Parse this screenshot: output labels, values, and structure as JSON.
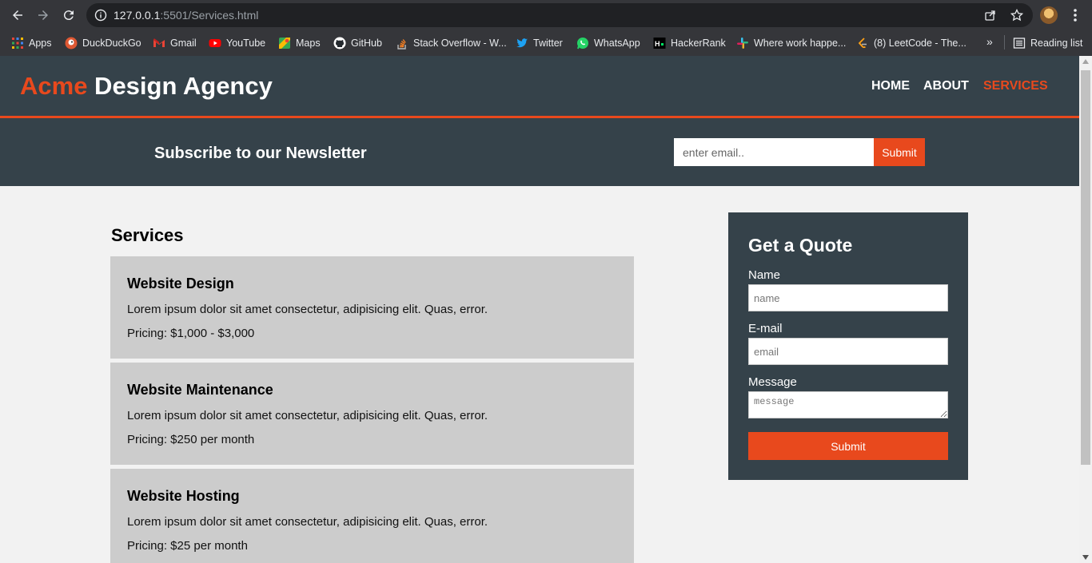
{
  "browser": {
    "url_host": "127.0.0.1",
    "url_rest": ":5501/Services.html",
    "bookmarks": [
      {
        "label": "Apps",
        "icon": "apps-grid-icon",
        "color": "#4285f4"
      },
      {
        "label": "DuckDuckGo",
        "icon": "duckduckgo-icon",
        "color": "#de5833"
      },
      {
        "label": "Gmail",
        "icon": "gmail-icon",
        "color": "#ea4335"
      },
      {
        "label": "YouTube",
        "icon": "youtube-icon",
        "color": "#ff0000"
      },
      {
        "label": "Maps",
        "icon": "maps-icon",
        "color": "#34a853"
      },
      {
        "label": "GitHub",
        "icon": "github-icon",
        "color": "#ffffff"
      },
      {
        "label": "Stack Overflow - W...",
        "icon": "stackoverflow-icon",
        "color": "#f48024"
      },
      {
        "label": "Twitter",
        "icon": "twitter-icon",
        "color": "#1da1f2"
      },
      {
        "label": "WhatsApp",
        "icon": "whatsapp-icon",
        "color": "#25d366"
      },
      {
        "label": "HackerRank",
        "icon": "hackerrank-icon",
        "color": "#000000"
      },
      {
        "label": "Where work happe...",
        "icon": "slack-icon",
        "color": "#e01e5a"
      },
      {
        "label": "(8) LeetCode - The...",
        "icon": "leetcode-icon",
        "color": "#ffa116"
      }
    ],
    "bookmarks_more": "»",
    "reading_list": "Reading list"
  },
  "site": {
    "brand_highlight": "Acme",
    "brand_rest": " Design Agency",
    "nav": [
      {
        "label": "Home",
        "active": false
      },
      {
        "label": "About",
        "active": false
      },
      {
        "label": "Services",
        "active": true
      }
    ],
    "accent_color": "#e8491d",
    "header_color": "#35424a"
  },
  "newsletter": {
    "title": "Subscribe to our Newsletter",
    "email_placeholder": "enter email..",
    "submit_label": "Submit"
  },
  "main": {
    "title": "Services",
    "services": [
      {
        "name": "Website Design",
        "description": "Lorem ipsum dolor sit amet consectetur, adipisicing elit. Quas, error.",
        "pricing": "Pricing: $1,000 - $3,000"
      },
      {
        "name": "Website Maintenance",
        "description": "Lorem ipsum dolor sit amet consectetur, adipisicing elit. Quas, error.",
        "pricing": "Pricing: $250 per month"
      },
      {
        "name": "Website Hosting",
        "description": "Lorem ipsum dolor sit amet consectetur, adipisicing elit. Quas, error.",
        "pricing": "Pricing: $25 per month"
      }
    ]
  },
  "quote": {
    "title": "Get a Quote",
    "name_label": "Name",
    "name_placeholder": "name",
    "email_label": "E-mail",
    "email_placeholder": "email",
    "message_label": "Message",
    "message_placeholder": "message",
    "submit_label": "Submit"
  }
}
